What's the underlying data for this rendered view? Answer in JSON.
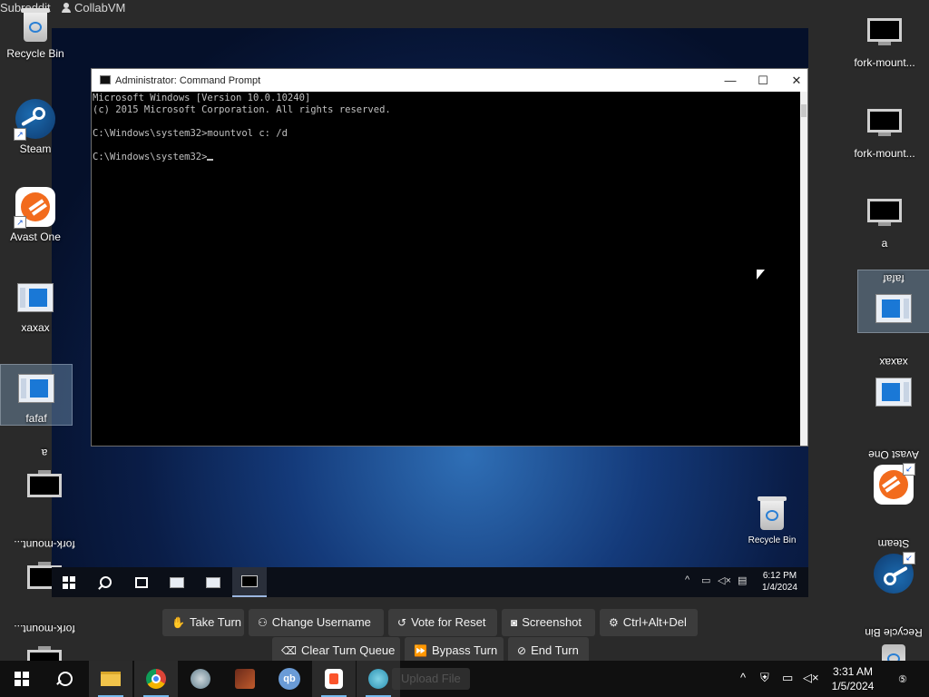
{
  "host": {
    "topbar": {
      "left_text": "Subreddit",
      "app_name": "CollabVM"
    },
    "left_icons": [
      {
        "label": "Recycle Bin",
        "type": "bin"
      },
      {
        "label": "Steam",
        "type": "steam"
      },
      {
        "label": "Avast One",
        "type": "avast"
      },
      {
        "label": "xaxax",
        "type": "window"
      },
      {
        "label": "fafaf",
        "type": "window",
        "selected": true
      },
      {
        "label": "a",
        "type": "monitor",
        "flipped": true
      },
      {
        "label": "fork-mount...",
        "type": "monitor",
        "flipped": true
      },
      {
        "label": "fork-mount...",
        "type": "monitor",
        "flipped": true
      }
    ],
    "right_icons": [
      {
        "label": "fork-mount...",
        "type": "monitor"
      },
      {
        "label": "fork-mount...",
        "type": "monitor"
      },
      {
        "label": "a",
        "type": "monitor"
      },
      {
        "label": "fafaf",
        "type": "window",
        "flipped": true,
        "selected": true
      },
      {
        "label": "xaxax",
        "type": "window",
        "flipped": true
      },
      {
        "label": "Avast One",
        "type": "avast",
        "flipped": true
      },
      {
        "label": "Steam",
        "type": "steam",
        "flipped": true
      },
      {
        "label": "Recycle Bin",
        "type": "bin",
        "flipped": true
      }
    ],
    "controls": {
      "take_turn": "Take Turn",
      "change_username": "Change Username",
      "vote_reset": "Vote for Reset",
      "screenshot": "Screenshot",
      "ctrl_alt_del": "Ctrl+Alt+Del",
      "clear_queue": "Clear Turn Queue",
      "bypass_turn": "Bypass Turn",
      "end_turn": "End Turn",
      "upload_file": "Upload File"
    },
    "taskbar": {
      "clock_time": "3:31 AM",
      "clock_date": "1/5/2024",
      "qbittorrent_label": "qb"
    }
  },
  "vm": {
    "recycle_bin_label": "Recycle Bin",
    "cmd_window": {
      "title": "Administrator: Command Prompt",
      "minimize": "—",
      "maximize": "☐",
      "close": "✕",
      "lines": [
        "Microsoft Windows [Version 10.0.10240]",
        "(c) 2015 Microsoft Corporation. All rights reserved.",
        "",
        "C:\\Windows\\system32>mountvol c: /d",
        "",
        "C:\\Windows\\system32>"
      ]
    },
    "taskbar": {
      "clock_time": "6:12 PM",
      "clock_date": "1/4/2024"
    }
  }
}
